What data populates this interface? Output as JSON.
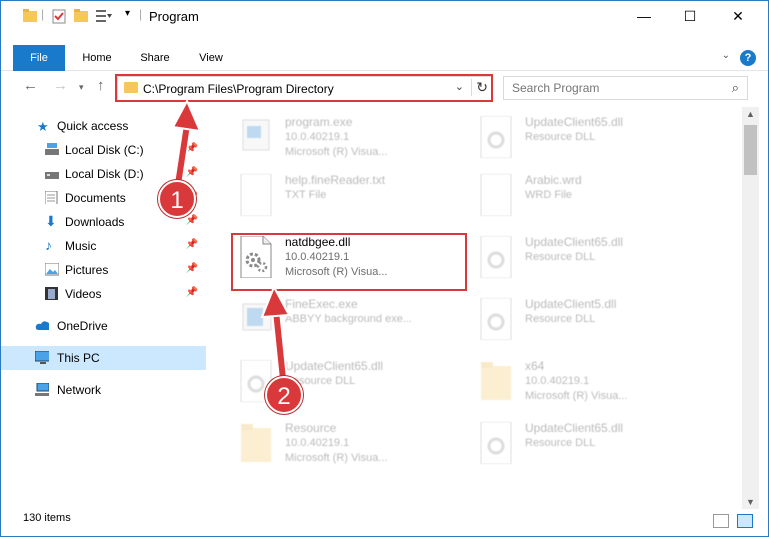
{
  "window": {
    "title": "Program"
  },
  "title_controls": {
    "minimize": "—",
    "maximize": "☐",
    "close": "✕"
  },
  "ribbon": {
    "tabs": [
      "File",
      "Home",
      "Share",
      "View"
    ],
    "help": "?"
  },
  "address": {
    "path": "C:\\Program Files\\Program Directory"
  },
  "search": {
    "placeholder": "Search Program"
  },
  "sidebar": {
    "items": [
      {
        "label": "Quick access"
      },
      {
        "label": "Local Disk (C:)"
      },
      {
        "label": "Local Disk (D:)"
      },
      {
        "label": "Documents"
      },
      {
        "label": "Downloads"
      },
      {
        "label": "Music"
      },
      {
        "label": "Pictures"
      },
      {
        "label": "Videos"
      },
      {
        "label": "OneDrive"
      },
      {
        "label": "This PC"
      },
      {
        "label": "Network"
      }
    ]
  },
  "files": [
    {
      "name": "program.exe",
      "line2": "10.0.40219.1",
      "line3": "Microsoft (R) Visua..."
    },
    {
      "name": "UpdateClient65.dll",
      "line2": "Resource DLL",
      "line3": ""
    },
    {
      "name": "help.fineReader.txt",
      "line2": "TXT File",
      "line3": ""
    },
    {
      "name": "Arabic.wrd",
      "line2": "WRD File",
      "line3": ""
    },
    {
      "name": "natdbgee.dll",
      "line2": "10.0.40219.1",
      "line3": "Microsoft (R) Visua..."
    },
    {
      "name": "UpdateClient65.dll",
      "line2": "Resource DLL",
      "line3": ""
    },
    {
      "name": "FineExec.exe",
      "line2": "ABBYY background exe...",
      "line3": ""
    },
    {
      "name": "UpdateClient5.dll",
      "line2": "Resource DLL",
      "line3": ""
    },
    {
      "name": "UpdateClient65.dll",
      "line2": "Resource DLL",
      "line3": ""
    },
    {
      "name": "x64",
      "line2": "10.0.40219.1",
      "line3": "Microsoft (R) Visua..."
    },
    {
      "name": "Resource",
      "line2": "10.0.40219.1",
      "line3": "Microsoft (R) Visua..."
    },
    {
      "name": "UpdateClient65.dll",
      "line2": "Resource DLL",
      "line3": ""
    }
  ],
  "status": {
    "count": "130 items"
  },
  "callouts": {
    "one": "1",
    "two": "2"
  },
  "colors": {
    "accent": "#1979ca",
    "highlight": "#d9393a",
    "selected": "#cce8ff"
  }
}
